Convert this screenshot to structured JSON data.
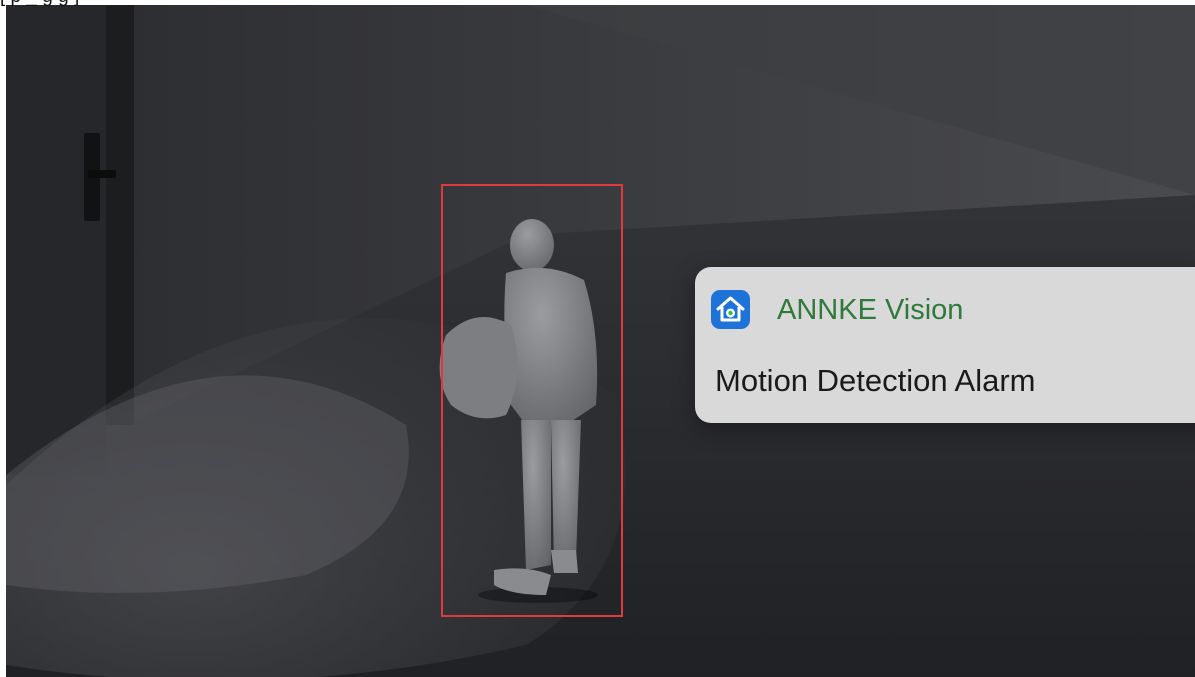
{
  "header": {
    "caption_fragment": "[ p                    _                g       g                ]"
  },
  "scene": {
    "detection_box_color": "#e03a3e",
    "background_color": "#2f3033"
  },
  "notification": {
    "app_icon": "home-camera-icon",
    "app_name": "ANNKE Vision",
    "message": "Motion Detection Alarm",
    "accent_color": "#1e73d9",
    "app_name_color": "#2f7a3a"
  }
}
